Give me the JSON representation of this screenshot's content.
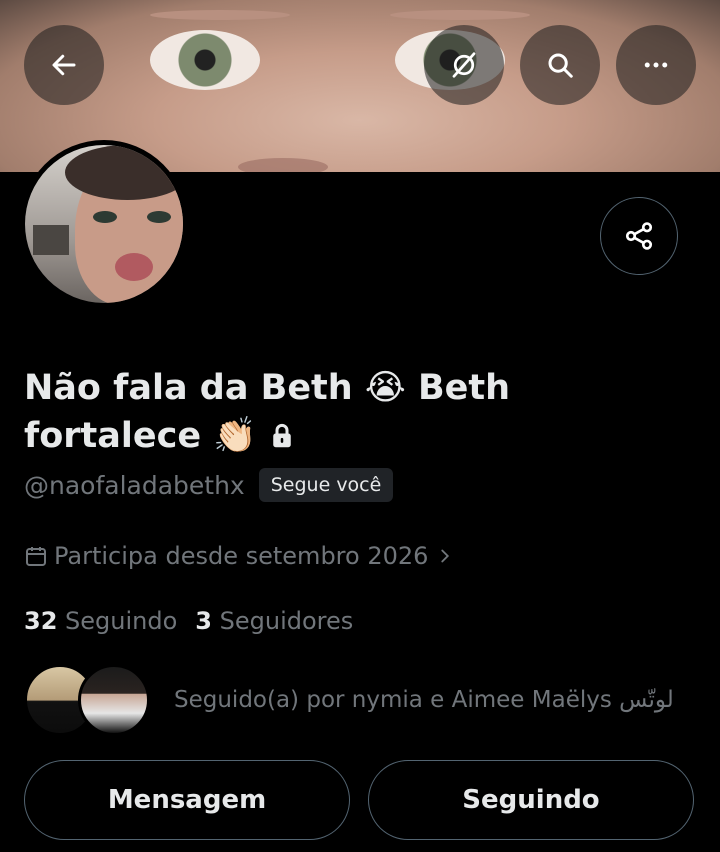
{
  "header": {
    "back_icon": "arrow-left-icon",
    "grok_icon": "grok-icon",
    "search_icon": "search-icon",
    "more_icon": "more-horizontal-icon"
  },
  "profile": {
    "name_line1": "Não fala da Beth 😭 Beth",
    "name_line2": "fortalece 👏🏻",
    "lock_icon": "lock-icon",
    "handle": "@naofaladabethx",
    "follows_you": "Segue você",
    "joined": "Participa desde setembro 2026",
    "following_count": "32",
    "following_label": "Seguindo",
    "followers_count": "3",
    "followers_label": "Seguidores",
    "followed_by": "Seguido(a) por nymia e Aimee Maëlys لوتّس"
  },
  "actions": {
    "message": "Mensagem",
    "following": "Seguindo"
  },
  "colors": {
    "background": "#000000",
    "text_primary": "#e7e9ea",
    "text_secondary": "#71767b",
    "border": "#536471"
  }
}
